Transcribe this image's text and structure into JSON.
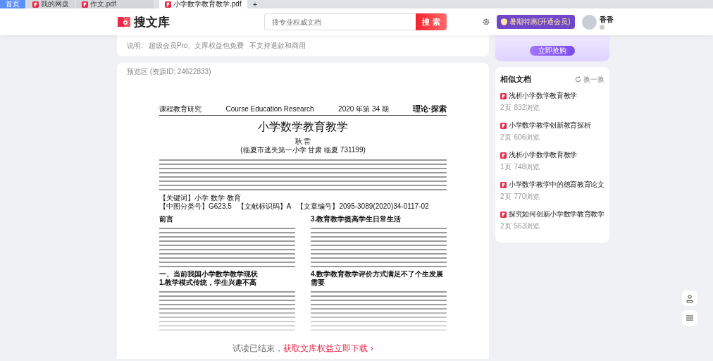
{
  "browser_tabs": [
    {
      "label": "首页",
      "kind": "home",
      "selected": false
    },
    {
      "label": "我的网盘",
      "kind": "pdf",
      "selected": false
    },
    {
      "label": "作文.pdf",
      "kind": "pdf",
      "selected": false
    },
    {
      "label": "小学数学教育教学.pdf",
      "kind": "pdf",
      "selected": true
    }
  ],
  "new_tab": "+",
  "header": {
    "logo": "搜文库",
    "search": {
      "placeholder": "搜专业权威文档",
      "button": "搜 索"
    },
    "promo_button": "暑期特惠(开通会员)",
    "user": {
      "name": "香香"
    }
  },
  "notice": {
    "label": "说明:",
    "text": "超级会员Pro、文库权益包免费",
    "restriction": "不支持退款和商用"
  },
  "preview": {
    "label": "预览区 (资源ID: 24622833)",
    "document": {
      "journal": "课程教育研究",
      "journal_en": "Course Education Research",
      "issue": "2020 年第 34 期",
      "section": "理论·探索",
      "title": "小学数学教育教学",
      "author": "耿 雷",
      "affiliation": "(临夏市逃失第一小学  甘肃  临夏  731199)",
      "keywords": "【关键词】小学  数学  教育",
      "classification": [
        "【中图分类号】G623.5",
        "【文献标识码】A",
        "【文章编号】2095-3089(2020)34-0117-02"
      ],
      "columns": [
        [
          {
            "kind": "subsection",
            "text": "前言"
          },
          {
            "kind": "section",
            "text": "一、当前我国小学数学教学现状"
          },
          {
            "kind": "subsection",
            "text": "1.教学模式传统，学生兴趣不高"
          }
        ],
        [
          {
            "kind": "subsection",
            "text": "3.教育教学提高学生日常生活"
          },
          {
            "kind": "subsection",
            "text": "4.数学教育教学评价方式满足不了个生发展需要"
          }
        ]
      ]
    },
    "cta": {
      "text": "试读已结束，",
      "link": "获取文库权益立即下载",
      "arrow": "›"
    }
  },
  "promo_card": {
    "button": "立即抢购"
  },
  "similar": {
    "title": "相似文档",
    "refresh": "换一换",
    "items": [
      {
        "title": "浅析小学数学教育教学",
        "pages": "2页",
        "views": "832浏览"
      },
      {
        "title": "小学数学教学创新教育探析",
        "pages": "2页",
        "views": "606浏览"
      },
      {
        "title": "浅析小学数学教育教学",
        "pages": "1页",
        "views": "748浏览"
      },
      {
        "title": "小学数学教学中的德育教育论文",
        "pages": "2页",
        "views": "770浏览"
      },
      {
        "title": "探究如何创新小学数学教育教学",
        "pages": "2页",
        "views": "563浏览"
      }
    ]
  }
}
